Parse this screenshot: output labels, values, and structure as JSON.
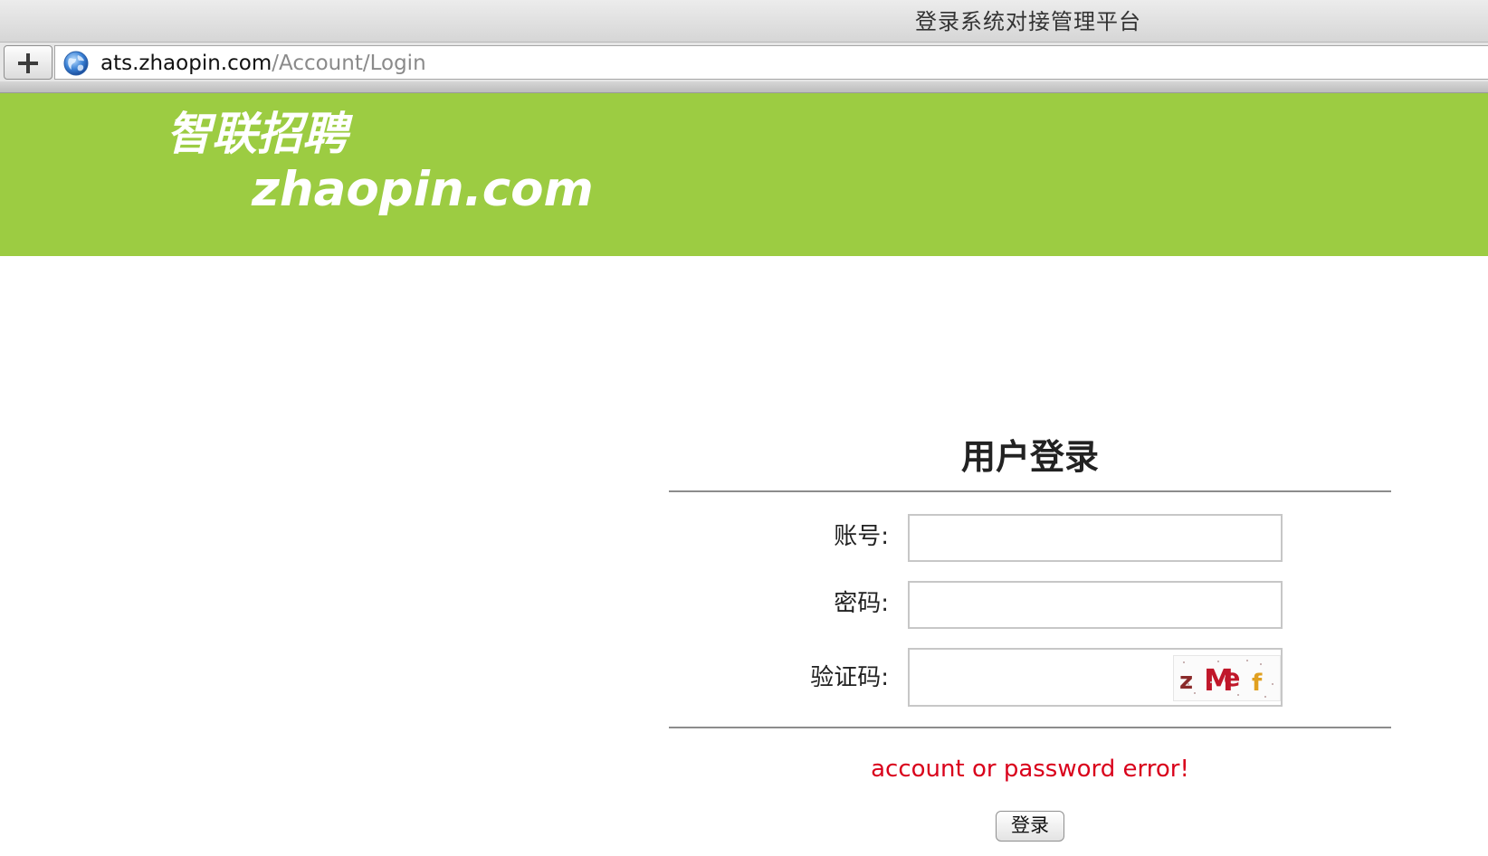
{
  "window": {
    "title": "登录系统对接管理平台"
  },
  "toolbar": {
    "new_tab_icon": "plus-icon",
    "site_icon": "globe-icon",
    "url_host": "ats.zhaopin.com",
    "url_path": "/Account/Login"
  },
  "header": {
    "logo_cn": "智联招聘",
    "logo_en": "zhaopin.com",
    "bg_color": "#9ccc42"
  },
  "login": {
    "title": "用户登录",
    "account_label": "账号:",
    "account_value": "",
    "password_label": "密码:",
    "password_value": "",
    "captcha_label": "验证码:",
    "captcha_value": "",
    "captcha_chars": [
      {
        "ch": "z",
        "color": "#8a2a2a"
      },
      {
        "ch": "M",
        "color": "#c0172a"
      },
      {
        "ch": "e",
        "color": "#c0172a"
      },
      {
        "ch": "f",
        "color": "#e0a020"
      }
    ],
    "error_message": "account or password error!",
    "error_color": "#d9001b",
    "submit_label": "登录"
  }
}
